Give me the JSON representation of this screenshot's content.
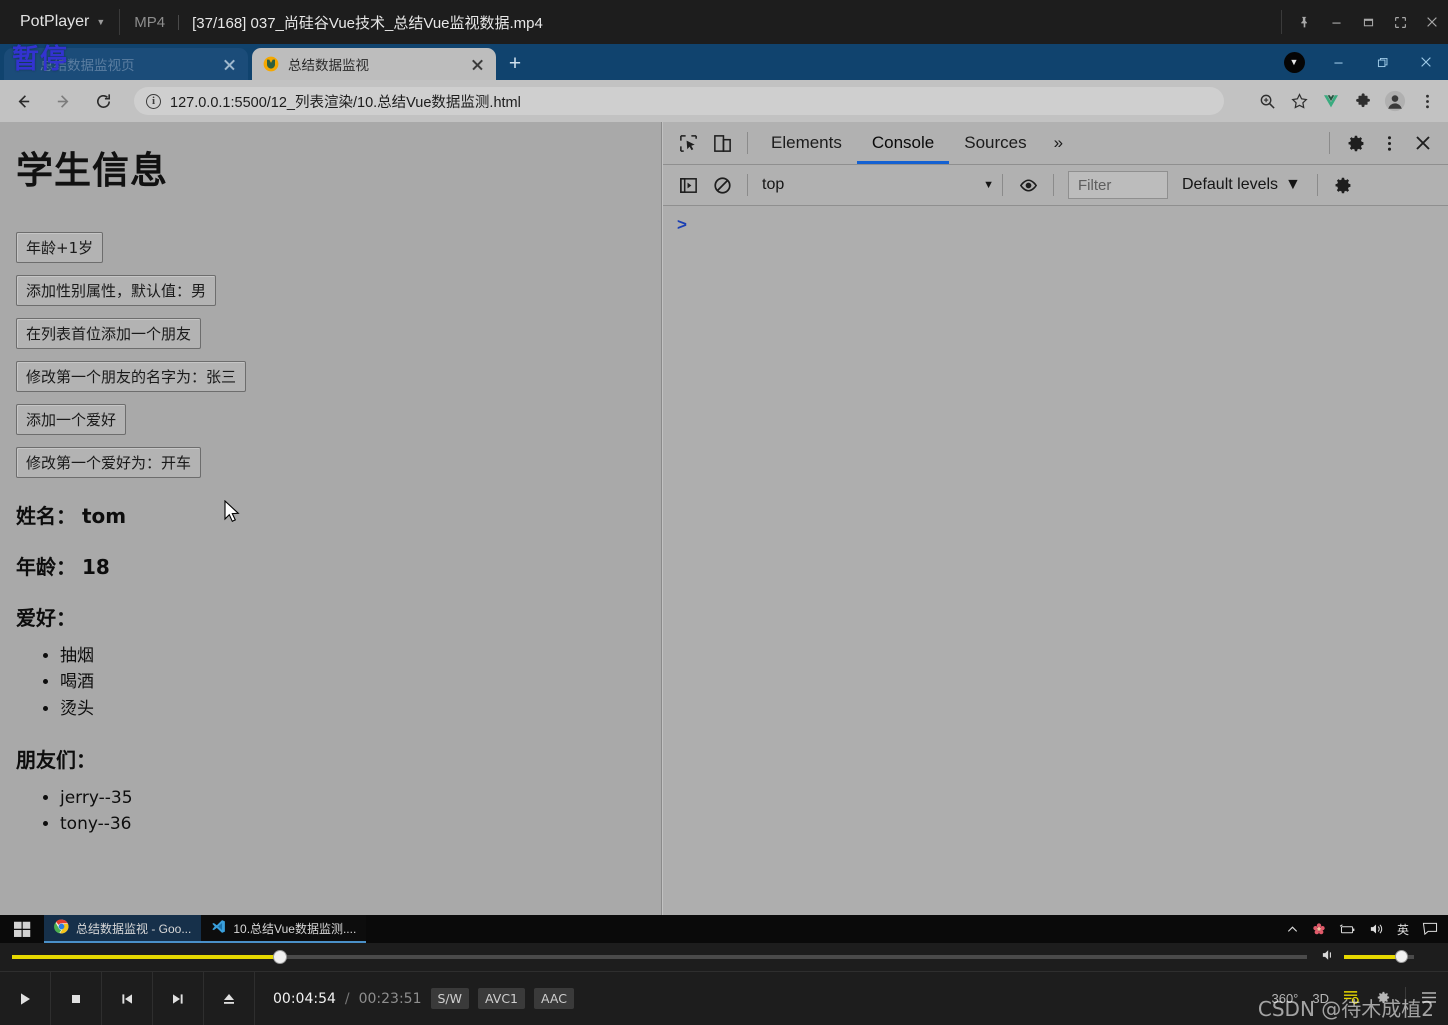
{
  "potplayer": {
    "app_name": "PotPlayer",
    "caret_icon": "chevron-down-icon",
    "format_label": "MP4",
    "file_title": "[37/168] 037_尚硅谷Vue技术_总结Vue监视数据.mp4",
    "window_buttons": [
      {
        "name": "pin-icon",
        "label": ""
      },
      {
        "name": "minimize-icon",
        "label": ""
      },
      {
        "name": "maximize-icon",
        "label": ""
      },
      {
        "name": "fullscreen-icon",
        "label": ""
      },
      {
        "name": "close-icon",
        "label": ""
      }
    ],
    "seek": {
      "current_percent": 20.7,
      "volume_percent": 82
    },
    "transport": [
      {
        "name": "play-button",
        "icon": "play-icon"
      },
      {
        "name": "stop-button",
        "icon": "stop-icon"
      },
      {
        "name": "previous-button",
        "icon": "previous-icon"
      },
      {
        "name": "next-button",
        "icon": "next-icon"
      },
      {
        "name": "eject-button",
        "icon": "eject-icon"
      }
    ],
    "time_current": "00:04:54",
    "time_separator": "/",
    "time_total": "00:23:51",
    "badges": [
      "S/W",
      "AVC1",
      "AAC"
    ],
    "right_controls": [
      "360°",
      "3D"
    ],
    "watermark": "CSDN @待木成植2"
  },
  "chrome": {
    "tabs": [
      {
        "title": "总结数据监视页",
        "active": false,
        "favicon": "none-icon",
        "overlay_text": "暂停"
      },
      {
        "title": "总结数据监视",
        "active": true,
        "favicon": "vue-favicon"
      }
    ],
    "new_tab_label": "+",
    "window_buttons": [
      {
        "name": "download-indicator",
        "label": ""
      },
      {
        "name": "minimize-icon",
        "label": ""
      },
      {
        "name": "restore-icon",
        "label": ""
      },
      {
        "name": "close-icon",
        "label": ""
      }
    ],
    "nav": {
      "back_label": "←",
      "forward_label": "→",
      "reload_label": "⟳"
    },
    "omnibox": {
      "info_label": "i",
      "url": "127.0.0.1:5500/12_列表渲染/10.总结Vue数据监测.html"
    },
    "toolbar_icons": [
      {
        "name": "zoom-icon"
      },
      {
        "name": "bookmark-star-icon"
      },
      {
        "name": "vue-devtools-icon"
      },
      {
        "name": "extensions-puzzle-icon"
      },
      {
        "name": "profile-avatar-icon"
      },
      {
        "name": "chrome-menu-icon"
      }
    ]
  },
  "page": {
    "heading": "学生信息",
    "buttons": [
      "年龄+1岁",
      "添加性别属性，默认值：男",
      "在列表首位添加一个朋友",
      "修改第一个朋友的名字为：张三",
      "添加一个爱好",
      "修改第一个爱好为：开车"
    ],
    "fields": [
      {
        "label": "姓名：",
        "value": "tom"
      },
      {
        "label": "年龄：",
        "value": "18"
      }
    ],
    "hobbies_label": "爱好：",
    "hobbies": [
      "抽烟",
      "喝酒",
      "烫头"
    ],
    "friends_label": "朋友们：",
    "friends": [
      "jerry--35",
      "tony--36"
    ],
    "background_color": "#a9a9a9"
  },
  "devtools": {
    "left_icons": [
      {
        "name": "inspect-element-icon"
      },
      {
        "name": "device-toolbar-icon"
      }
    ],
    "tabs": [
      {
        "label": "Elements",
        "selected": false
      },
      {
        "label": "Console",
        "selected": true
      },
      {
        "label": "Sources",
        "selected": false
      }
    ],
    "more_tabs_label": "»",
    "right_icons": [
      {
        "name": "devtools-settings-icon"
      },
      {
        "name": "devtools-more-icon"
      },
      {
        "name": "devtools-close-icon"
      }
    ],
    "console_toolbar": {
      "sidebar_toggle_icon": "console-sidebar-icon",
      "clear_icon": "clear-console-icon",
      "context_value": "top",
      "context_caret": "▼",
      "eye_icon": "live-expression-eye-icon",
      "filter_placeholder": "Filter",
      "filter_value": "",
      "levels_label": "Default levels",
      "levels_caret": "▼",
      "settings_icon": "console-settings-icon"
    },
    "prompt_symbol": ">",
    "accent_color": "#1461d2"
  },
  "taskbar": {
    "start_icon": "windows-logo-icon",
    "items": [
      {
        "label": "总结数据监视 - Goo...",
        "icon": "chrome-icon"
      },
      {
        "label": "10.总结Vue数据监测....",
        "icon": "vscode-icon"
      }
    ],
    "tray": [
      {
        "name": "tray-chevron-up-icon",
        "label": "^"
      },
      {
        "name": "tray-flower-icon",
        "label": ""
      },
      {
        "name": "tray-battery-icon",
        "label": ""
      },
      {
        "name": "tray-volume-icon",
        "label": ""
      },
      {
        "name": "tray-ime-icon",
        "label": "英"
      },
      {
        "name": "tray-notifications-icon",
        "label": ""
      }
    ]
  }
}
